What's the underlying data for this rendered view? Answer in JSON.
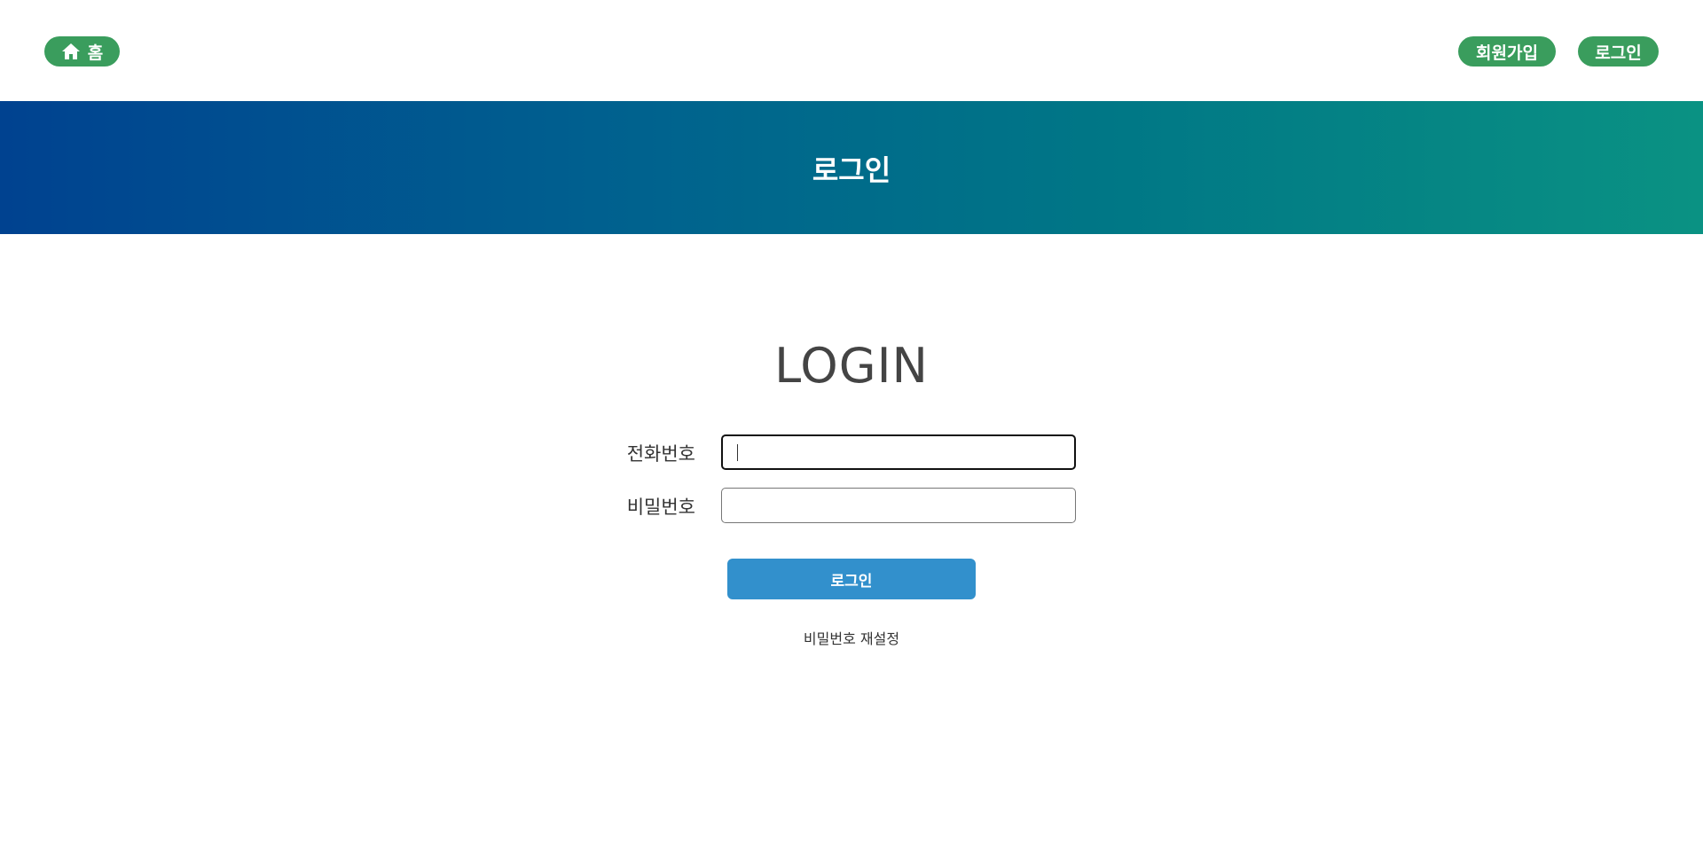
{
  "header": {
    "home_label": "홈",
    "home_icon": "home-icon",
    "signup_label": "회원가입",
    "login_label": "로그인",
    "accent_color": "#3a9d5d"
  },
  "banner": {
    "title": "로그인",
    "gradient_start": "#004290",
    "gradient_end": "#0a9283"
  },
  "form": {
    "heading": "LOGIN",
    "phone_label": "전화번호",
    "phone_value": "",
    "password_label": "비밀번호",
    "password_value": "",
    "submit_label": "로그인",
    "submit_color": "#3290cc",
    "reset_link": "비밀번호 재설정"
  }
}
